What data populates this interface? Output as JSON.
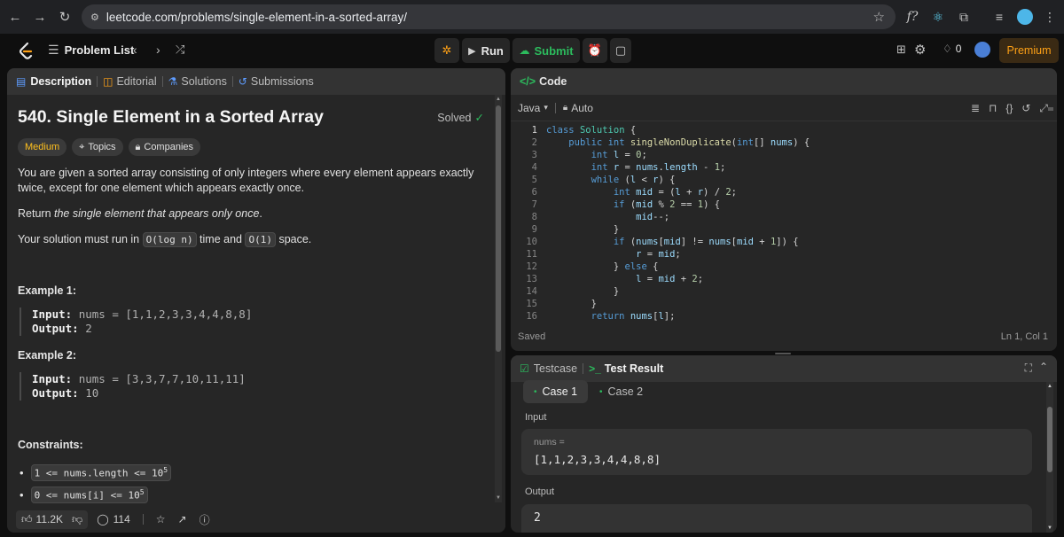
{
  "browser": {
    "url": "leetcode.com/problems/single-element-in-a-sorted-array/"
  },
  "nav": {
    "problem_list": "Problem List",
    "run": "Run",
    "submit": "Submit",
    "streak": "0",
    "premium": "Premium"
  },
  "left": {
    "tabs": [
      "Description",
      "Editorial",
      "Solutions",
      "Submissions"
    ],
    "title": "540. Single Element in a Sorted Array",
    "solved": "Solved",
    "difficulty": "Medium",
    "topics": "Topics",
    "companies": "Companies",
    "desc1": "You are given a sorted array consisting of only integers where every element appears exactly twice, except for one element which appears exactly once.",
    "desc2_pre": "Return ",
    "desc2_em": "the single element that appears only once",
    "desc2_post": ".",
    "desc3_pre": "Your solution must run in ",
    "desc3_code1": "O(log n)",
    "desc3_mid": " time and ",
    "desc3_code2": "O(1)",
    "desc3_post": " space.",
    "examples": [
      {
        "title": "Example 1:",
        "input_label": "Input:",
        "input": "nums = [1,1,2,3,3,4,4,8,8]",
        "output_label": "Output:",
        "output": "2"
      },
      {
        "title": "Example 2:",
        "input_label": "Input:",
        "input": "nums = [3,3,7,7,10,11,11]",
        "output_label": "Output:",
        "output": "10"
      }
    ],
    "constraints_title": "Constraints:",
    "constraint1": "1 <= nums.length <= 10",
    "constraint1_sup": "5",
    "constraint2": "0 <= nums[i] <= 10",
    "constraint2_sup": "5",
    "likes": "11.2K",
    "comments": "114"
  },
  "editor": {
    "header": "Code",
    "language": "Java",
    "auto": "Auto",
    "saved": "Saved",
    "cursor": "Ln 1, Col 1",
    "lines": [
      "class Solution {",
      "    public int singleNonDuplicate(int[] nums) {",
      "        int l = 0;",
      "        int r = nums.length - 1;",
      "        while (l < r) {",
      "            int mid = (l + r) / 2;",
      "            if (mid % 2 == 1) {",
      "                mid--;",
      "            }",
      "            if (nums[mid] != nums[mid + 1]) {",
      "                r = mid;",
      "            } else {",
      "                l = mid + 2;",
      "            }",
      "        }",
      "        return nums[l];"
    ]
  },
  "tests": {
    "tab_testcase": "Testcase",
    "tab_result": "Test Result",
    "case1": "Case 1",
    "case2": "Case 2",
    "input_label": "Input",
    "param": "nums =",
    "param_value": "[1,1,2,3,3,4,4,8,8]",
    "output_label": "Output",
    "output_value": "2"
  },
  "colors": {
    "medium": "#ffc01e",
    "solved": "#2cbb5d",
    "submit": "#2cbb5d",
    "premium": "#ffa116"
  }
}
